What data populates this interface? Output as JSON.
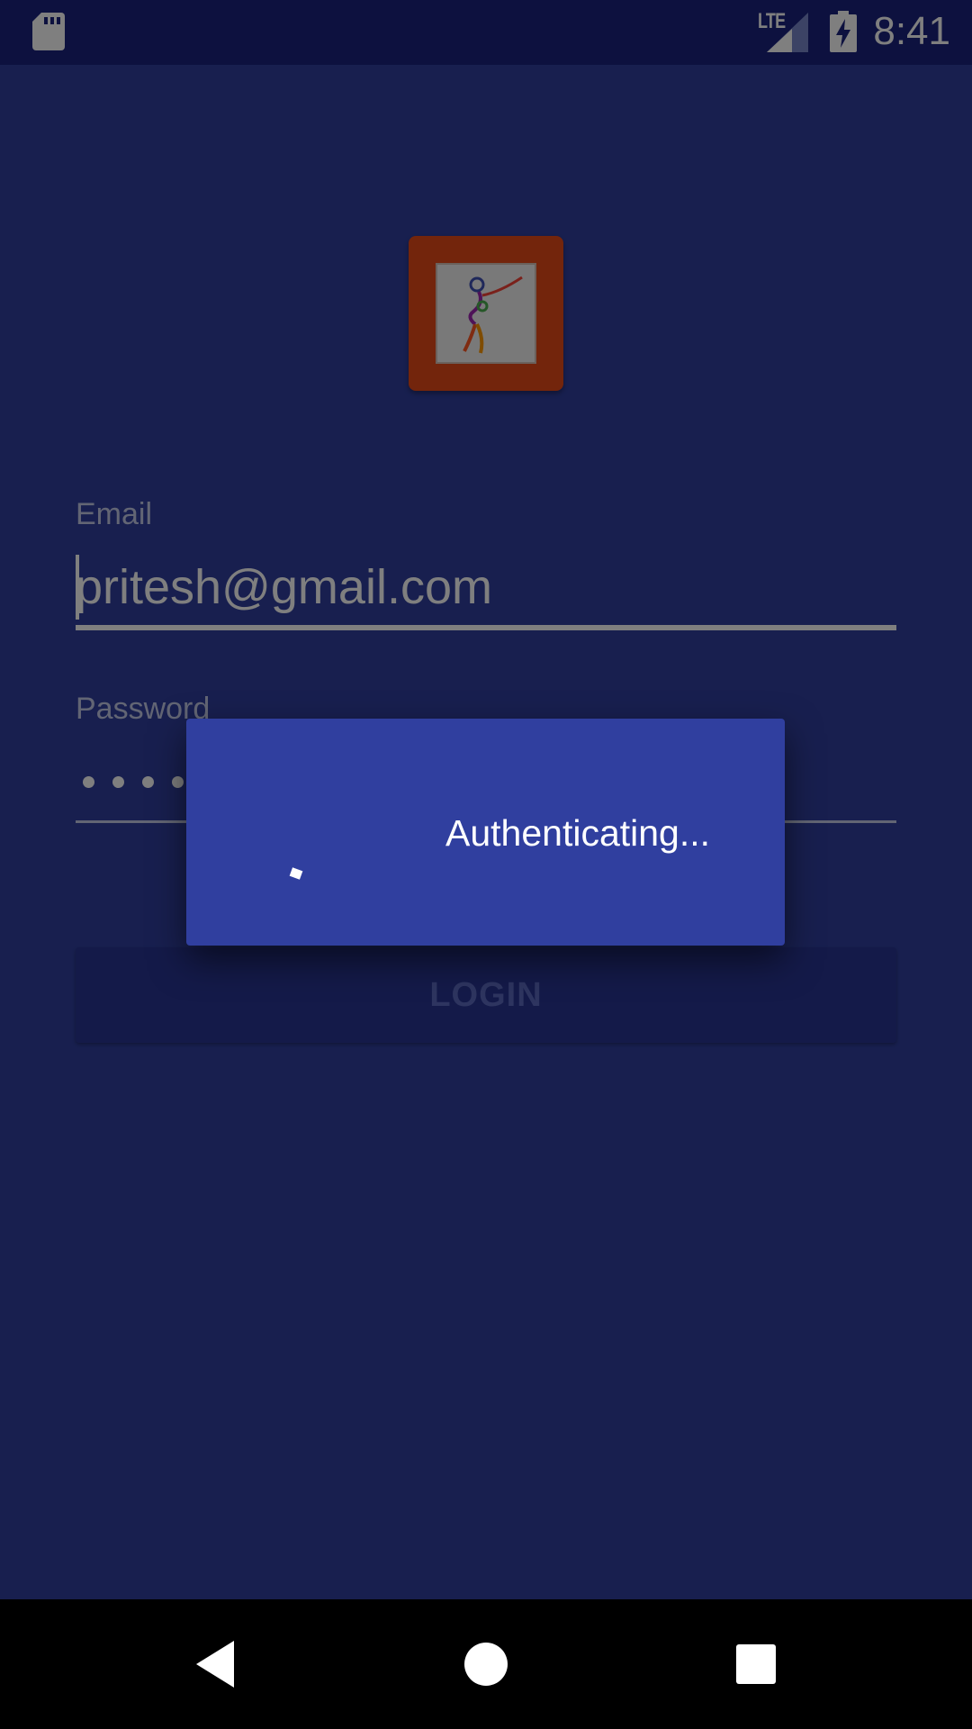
{
  "status_bar": {
    "time": "8:41",
    "network_type": "LTE",
    "icons": [
      "sd-card-icon",
      "signal-icon",
      "battery-charging-icon"
    ]
  },
  "login_form": {
    "logo_icon": "app-logo-icon",
    "email_label": "Email",
    "email_value": "pritesh@gmail.com",
    "password_label": "Password",
    "password_masked_char_count": 4,
    "login_button_label": "LOGIN"
  },
  "progress_dialog": {
    "message": "Authenticating...",
    "spinner_icon": "progress-spinner-icon"
  },
  "nav_bar": {
    "icons": [
      "back-icon",
      "home-icon",
      "recents-icon"
    ]
  },
  "colors": {
    "primary": "#303f9f",
    "primary_dark": "#1a237e",
    "logo_accent": "#e64a19",
    "nav_background": "#000000",
    "scrim": "rgba(0,0,0,0.5)"
  }
}
